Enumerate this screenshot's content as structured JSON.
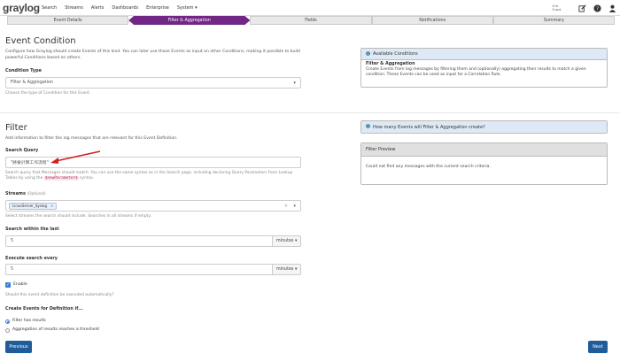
{
  "nav": {
    "logo": "graylog",
    "links": [
      "Search",
      "Streams",
      "Alerts",
      "Dashboards",
      "Enterprise",
      "System ▾"
    ],
    "throughput_in": "0 in",
    "throughput_out": "0 out",
    "icons": [
      "edit-icon",
      "help-icon",
      "user-icon"
    ]
  },
  "steps": [
    "Event Details",
    "Filter & Aggregation",
    "Fields",
    "Notifications",
    "Summary"
  ],
  "event_condition": {
    "title": "Event Condition",
    "desc": "Configure how Graylog should create Events of this kind. You can later use those Events as input on other Conditions, making it possible to build powerful Conditions based on others.",
    "type_label": "Condition Type",
    "type_value": "Filter & Aggregation",
    "type_help": "Choose the type of Condition for this Event."
  },
  "available_conditions": {
    "title": "Available Conditions",
    "subtitle": "Filter & Aggregation",
    "body": "Create Events from log messages by filtering them and (optionally) aggregating their results to match a given condition. These Events can be used as input for a Correlation Rule."
  },
  "filter": {
    "title": "Filter",
    "desc": "Add information to filter the log messages that are relevant for this Event Definition.",
    "query_label": "Search Query",
    "query_value": "\"將會計算工作流程\"",
    "query_help_1": "Search query that Messages should match. You can use the same syntax as in the Search page, including declaring Query Parameters from",
    "query_help_2": "Lookup Tables by using the",
    "query_help_code": "$newParameter$",
    "query_help_3": "syntax.",
    "streams_label": "Streams",
    "streams_optional": "(Optional)",
    "stream_tag": "LinuxServer_Syslog",
    "stream_tag_x": "×",
    "streams_help": "Select streams the search should include. Searches in all streams if empty.",
    "within_label": "Search within the last",
    "within_value": "5",
    "within_unit": "minutes ▾",
    "every_label": "Execute search every",
    "every_value": "5",
    "every_unit": "minutes ▾",
    "enable_label": "Enable",
    "enable_help": "Should this event definition be executed automatically?",
    "create_label": "Create Events for Definition if...",
    "opt1": "Filter has results",
    "opt2": "Aggregation of results reaches a threshold"
  },
  "how_many": {
    "title": "How many Events will Filter & Aggregation create?"
  },
  "preview": {
    "title": "Filter Preview",
    "body": "Could not find any messages with the current search criteria."
  },
  "buttons": {
    "previous": "Previous",
    "next": "Next"
  },
  "colors": {
    "active_step": "#702785",
    "primary_button": "#1f5c99",
    "annotation_arrow": "#d21f1f"
  }
}
